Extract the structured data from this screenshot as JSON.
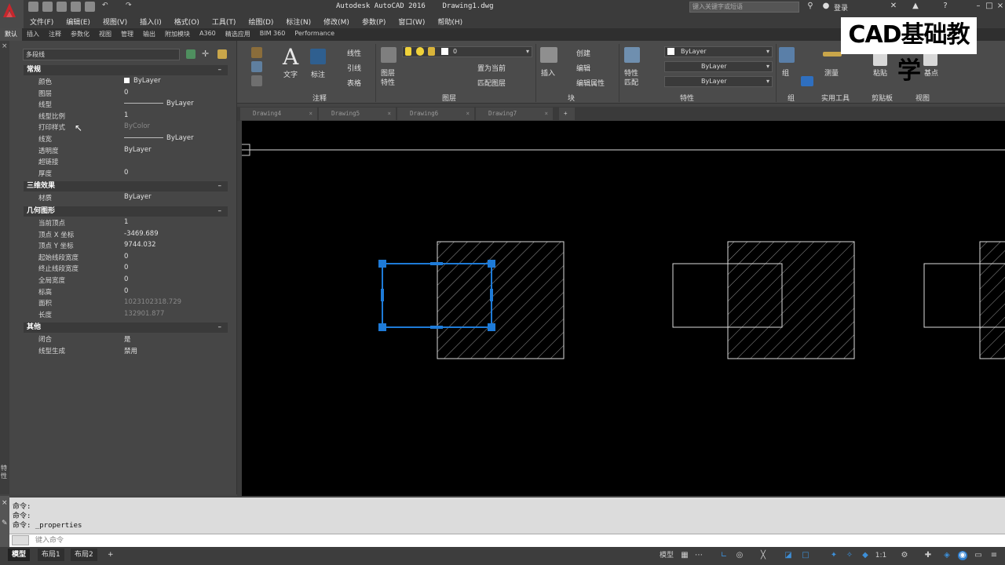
{
  "titlebar": {
    "title": "Autodesk AutoCAD 2016    Drawing1.dwg",
    "search_placeholder": "键入关键字或短语",
    "login": "登录"
  },
  "menu": [
    "文件(F)",
    "编辑(E)",
    "视图(V)",
    "插入(I)",
    "格式(O)",
    "工具(T)",
    "绘图(D)",
    "标注(N)",
    "修改(M)",
    "参数(P)",
    "窗口(W)",
    "帮助(H)"
  ],
  "ribbon_tabs": [
    "默认",
    "插入",
    "注释",
    "参数化",
    "视图",
    "管理",
    "输出",
    "附加模块",
    "A360",
    "精选应用",
    "BIM 360",
    "Performance"
  ],
  "ribbon": {
    "text_label": "文字",
    "dim_label": "标注",
    "linear": "线性",
    "leader": "引线",
    "table": "表格",
    "annotate_panel": "注释",
    "layer_props": "图层\n特性",
    "layer_props_1": "图层",
    "layer_props_2": "特性",
    "layer_combo": "0",
    "set_current": "置为当前",
    "match_layer": "匹配图层",
    "layers_panel": "图层",
    "insert": "插入",
    "create": "创建",
    "edit": "编辑",
    "edit_attr": "编辑属性",
    "block_panel": "块",
    "match_props_1": "特性",
    "match_props_2": "匹配",
    "bylayer_color": "ByLayer",
    "bylayer_linetype": "ByLayer",
    "bylayer_lineweight": "ByLayer",
    "properties_panel": "特性",
    "group": "组",
    "group_panel": "组",
    "measure": "测量",
    "utilities_panel": "实用工具",
    "paste": "粘贴",
    "clipboard_panel": "剪贴板",
    "base": "基点",
    "view_panel": "视图"
  },
  "watermark": "CAD基础教学",
  "doc_tabs": [
    "Drawing4",
    "Drawing5",
    "Drawing6",
    "Drawing7"
  ],
  "properties": {
    "object_type": "多段线",
    "sections": [
      {
        "title": "常规",
        "rows": [
          {
            "name": "颜色",
            "value": "ByLayer"
          },
          {
            "name": "图层",
            "value": "0"
          },
          {
            "name": "线型",
            "value": "ByLayer"
          },
          {
            "name": "线型比例",
            "value": "1"
          },
          {
            "name": "打印样式",
            "value": "ByColor"
          },
          {
            "name": "线宽",
            "value": "ByLayer"
          },
          {
            "name": "透明度",
            "value": "ByLayer"
          },
          {
            "name": "超链接",
            "value": ""
          },
          {
            "name": "厚度",
            "value": "0"
          }
        ]
      },
      {
        "title": "三维效果",
        "rows": [
          {
            "name": "材质",
            "value": "ByLayer"
          }
        ]
      },
      {
        "title": "几何图形",
        "rows": [
          {
            "name": "当前顶点",
            "value": "1"
          },
          {
            "name": "顶点 X 坐标",
            "value": "-3469.689"
          },
          {
            "name": "顶点 Y 坐标",
            "value": "9744.032"
          },
          {
            "name": "起始线段宽度",
            "value": "0"
          },
          {
            "name": "终止线段宽度",
            "value": "0"
          },
          {
            "name": "全局宽度",
            "value": "0"
          },
          {
            "name": "标高",
            "value": "0"
          },
          {
            "name": "面积",
            "value": "1023102318.729"
          },
          {
            "name": "长度",
            "value": "132901.877"
          }
        ]
      },
      {
        "title": "其他",
        "rows": [
          {
            "name": "闭合",
            "value": "是"
          },
          {
            "name": "线型生成",
            "value": "禁用"
          }
        ]
      }
    ]
  },
  "palette_side_label": "特性",
  "command": {
    "lines": [
      "命令:",
      "命令:",
      "命令: _properties"
    ],
    "input_placeholder": "键入命令"
  },
  "layout_tabs": [
    "模型",
    "布局1",
    "布局2"
  ],
  "status": {
    "model": "模型",
    "scale": "1:1"
  },
  "colors": {
    "selection_blue": "#1e7bd8",
    "drawing_bg": "#000000",
    "line_white": "#ffffff"
  }
}
